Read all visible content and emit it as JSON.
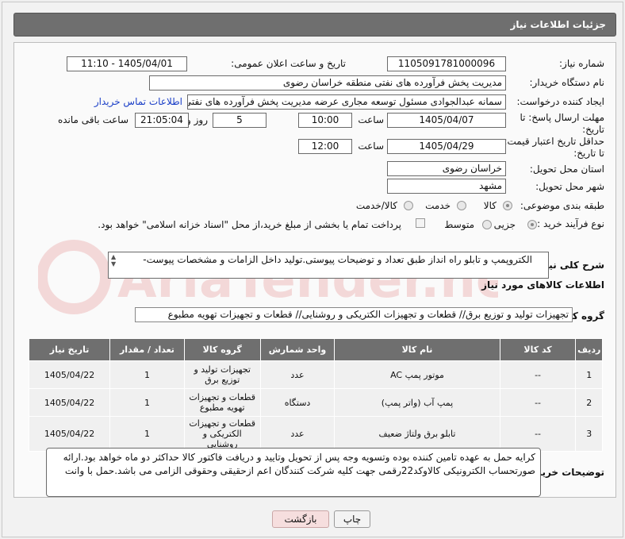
{
  "header": {
    "title": "جزئیات اطلاعات نیاز"
  },
  "fields": {
    "need_number_label": "شماره نیاز:",
    "need_number": "1105091781000096",
    "announce_label": "تاریخ و ساعت اعلان عمومی:",
    "announce_value": "1405/04/01 - 11:10",
    "buyer_org_label": "نام دستگاه خریدار:",
    "buyer_org": "مدیریت پخش فرآورده های نفتی منطقه خراسان رضوی",
    "requester_label": "ایجاد کننده درخواست:",
    "requester": "سمانه عبدالجوادی مسئول توسعه مجاری عرضه مدیریت پخش فرآورده های نفتی",
    "contact_link": "اطلاعات تماس خریدار",
    "deadline_label_1": "مهلت ارسال پاسخ: تا",
    "deadline_label_2": "تاریخ:",
    "deadline_date": "1405/04/07",
    "time_label": "ساعت",
    "deadline_time": "10:00",
    "days_value": "5",
    "days_label": "روز و",
    "remaining_time": "21:05:04",
    "remaining_label": "ساعت باقی مانده",
    "validity_label_1": "حداقل تاریخ اعتبار قیمت:",
    "validity_label_2": "تا تاریخ:",
    "validity_date": "1405/04/29",
    "validity_time": "12:00",
    "province_label": "استان محل تحویل:",
    "province": "خراسان رضوی",
    "city_label": "شهر محل تحویل:",
    "city": "مشهد",
    "category_label": "طبقه بندی موضوعی:",
    "category_options": [
      "کالا",
      "خدمت",
      "کالا/خدمت"
    ],
    "category_selected": "کالا",
    "process_label": "نوع فرآیند خرید :",
    "process_options": [
      "جزیی",
      "متوسط"
    ],
    "process_selected": "جزیی",
    "payment_note": "پرداخت تمام یا بخشی از مبلغ خرید،از محل \"اسناد خزانه اسلامی\" خواهد بود."
  },
  "description": {
    "label": "شرح کلی نیاز:",
    "text": "الکتروپمپ و تابلو راه انداز طبق تعداد و توضیحات پیوستی.تولید داخل الزامات و مشخصات پیوست-"
  },
  "goods": {
    "section_title": "اطلاعات کالاهای مورد نیاز",
    "group_label": "گروه کالا:",
    "group_value": "تجهیزات تولید و توزیع برق// قطعات و تجهیزات الکتریکی و روشنایی//  قطعات و تجهیزات تهویه مطبوع",
    "columns": [
      "ردیف",
      "کد کالا",
      "نام کالا",
      "واحد شمارش",
      "گروه کالا",
      "تعداد / مقدار",
      "تاریخ نیاز"
    ],
    "rows": [
      [
        "1",
        "--",
        "موتور پمپ AC",
        "عدد",
        "تجهیزات تولید و توزیع برق",
        "1",
        "1405/04/22"
      ],
      [
        "2",
        "--",
        "پمپ آب (واتر پمپ)",
        "دستگاه",
        "قطعات و تجهیزات تهویه مطبوع",
        "1",
        "1405/04/22"
      ],
      [
        "3",
        "--",
        "تابلو برق ولتاژ ضعیف",
        "عدد",
        "قطعات و تجهیزات الکتریکی و روشنایی",
        "1",
        "1405/04/22"
      ]
    ]
  },
  "buyer_notes": {
    "label": "توضیحات خریدار:",
    "text": "کرایه حمل به عهده تامین کننده بوده وتسویه وجه پس از تحویل وتایید و دریافت فاکتور کالا حداکثر دو ماه خواهد بود.ارائه صورتحساب الکترونیکی کالاوکد22رقمی جهت کلیه شرکت کنندگان اعم ازحقیقی وحقوقی الزامی می باشد.حمل با وانت"
  },
  "buttons": {
    "print": "چاپ",
    "back": "بازگشت"
  },
  "watermark": "AriaTender.net"
}
